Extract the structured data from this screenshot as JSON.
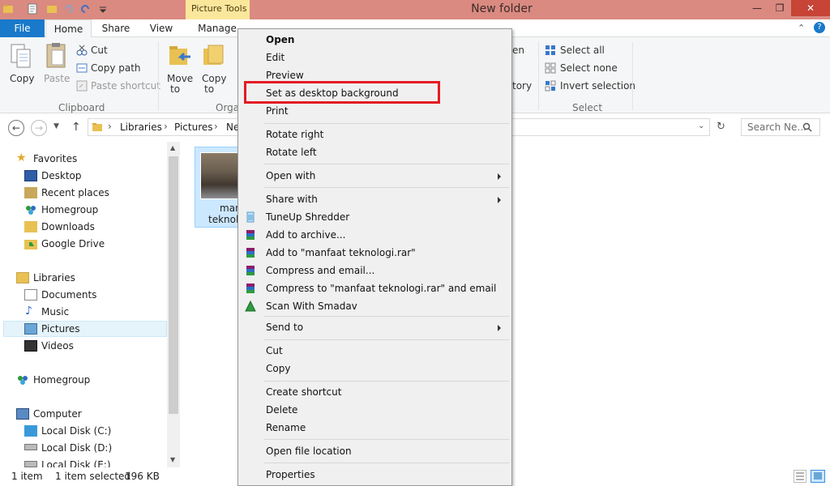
{
  "window": {
    "title": "New folder",
    "contextual_tab": "Picture Tools",
    "controls": [
      "minimize-icon",
      "restore-icon",
      "close-icon"
    ]
  },
  "tabs": {
    "file": "File",
    "home": "Home",
    "share": "Share",
    "view": "View",
    "manage": "Manage"
  },
  "ribbon": {
    "clipboard": {
      "copy": "Copy",
      "paste": "Paste",
      "cut": "Cut",
      "copy_path": "Copy path",
      "paste_shortcut": "Paste shortcut",
      "group": "Clipboard"
    },
    "organize": {
      "move_to": "Move",
      "move_to_2": "to",
      "copy_to": "Copy",
      "copy_to_2": "to",
      "group": "Orga"
    },
    "open_partial": {
      "open": "en",
      "history": "tory"
    },
    "select": {
      "select_all": "Select all",
      "select_none": "Select none",
      "invert": "Invert selection",
      "group": "Select"
    }
  },
  "address": {
    "crumbs": [
      "Libraries",
      "Pictures",
      "Ne"
    ],
    "search_placeholder": "Search Ne..."
  },
  "nav": {
    "favorites": "Favorites",
    "fav_items": [
      "Desktop",
      "Recent places",
      "Homegroup",
      "Downloads",
      "Google Drive"
    ],
    "libraries": "Libraries",
    "lib_items": [
      "Documents",
      "Music",
      "Pictures",
      "Videos"
    ],
    "homegroup": "Homegroup",
    "computer": "Computer",
    "drives": [
      "Local Disk (C:)",
      "Local Disk (D:)",
      "Local Disk (E:)"
    ]
  },
  "file": {
    "name_line1": "man",
    "name_line2": "teknolo"
  },
  "status": {
    "count": "1 item",
    "selected": "1 item selected",
    "size": "196 KB"
  },
  "context_menu": {
    "items": [
      "Open",
      "Edit",
      "Preview",
      "Set as desktop background",
      "Print",
      "Rotate right",
      "Rotate left",
      "Open with",
      "Share with",
      "TuneUp Shredder",
      "Add to archive...",
      "Add to \"manfaat teknologi.rar\"",
      "Compress and email...",
      "Compress to \"manfaat teknologi.rar\" and email",
      "Scan With Smadav",
      "Send to",
      "Cut",
      "Copy",
      "Create shortcut",
      "Delete",
      "Rename",
      "Open file location",
      "Properties"
    ],
    "highlighted_item": "Set as desktop background",
    "highlight_color": "#e31b23"
  },
  "colors": {
    "titlebar": "#da8a80",
    "file_tab": "#1979ca",
    "context_tab": "#fbe79c",
    "selection": "#cce8ff"
  }
}
